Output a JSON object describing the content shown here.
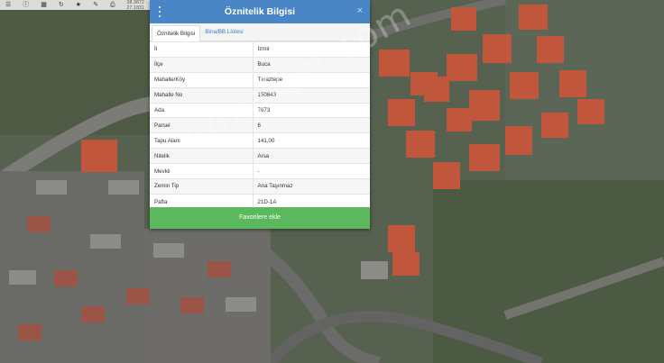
{
  "toolbar": {
    "icons": [
      "layers-icon",
      "info-icon",
      "grid-icon",
      "refresh-icon",
      "star-icon",
      "pen-icon",
      "print-icon"
    ],
    "coords": "38.3872 · 27.1831"
  },
  "dialog": {
    "title": "Öznitelik Bilgisi",
    "close_symbol": "×",
    "tabs": [
      {
        "label": "Öznitelik Bilgisi",
        "active": true
      },
      {
        "label": "Bina/BB Listesi",
        "active": false
      }
    ],
    "rows": [
      {
        "key": "İl",
        "value": "İzmir"
      },
      {
        "key": "İlçe",
        "value": "Buca"
      },
      {
        "key": "Mahalle/Köy",
        "value": "Tınaztepe"
      },
      {
        "key": "Mahalle No",
        "value": "150643"
      },
      {
        "key": "Ada",
        "value": "7673"
      },
      {
        "key": "Parsel",
        "value": "6"
      },
      {
        "key": "Tapu Alanı",
        "value": "141,00"
      },
      {
        "key": "Nitelik",
        "value": "Arsa"
      },
      {
        "key": "Mevkii",
        "value": "-"
      },
      {
        "key": "Zemin Tip",
        "value": "Ana Taşınmaz"
      },
      {
        "key": "Pafta",
        "value": "21D-1A"
      }
    ],
    "favorite_button": "Favorilere ekle"
  },
  "watermark": "emlakjet.com",
  "colors": {
    "header": "#4a86c6",
    "button": "#5cb85c",
    "tab_link": "#3a7bd5"
  }
}
